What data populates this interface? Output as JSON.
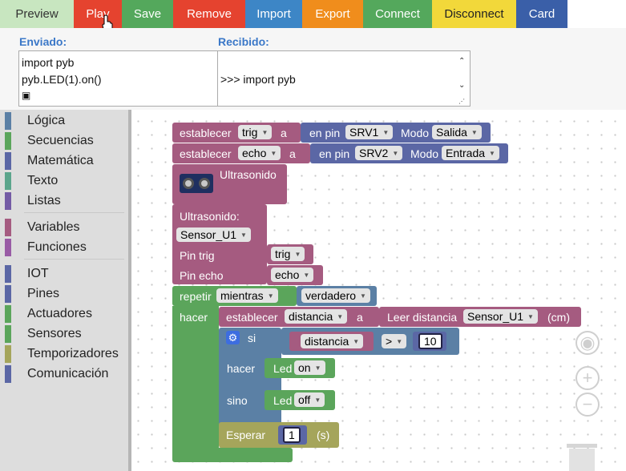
{
  "toolbar": {
    "preview": {
      "label": "Preview",
      "color": "#c8e6c0"
    },
    "play": {
      "label": "Play",
      "color": "#e5432f"
    },
    "save": {
      "label": "Save",
      "color": "#54a85c"
    },
    "remove": {
      "label": "Remove",
      "color": "#e5432f"
    },
    "import": {
      "label": "Import",
      "color": "#3d86c6"
    },
    "export": {
      "label": "Export",
      "color": "#f08d1c"
    },
    "connect": {
      "label": "Connect",
      "color": "#54a85c"
    },
    "disconnect": {
      "label": "Disconnect",
      "color": "#f2d83a"
    },
    "card": {
      "label": "Card",
      "color": "#3a5fa8"
    }
  },
  "console": {
    "sent_label": "Enviado:",
    "received_label": "Recibido:",
    "sent_lines": [
      "import pyb",
      "pyb.LED(1).on()"
    ],
    "received_text": ">>> import pyb"
  },
  "categories": [
    {
      "label": "Lógica",
      "color": "#5b80a5"
    },
    {
      "label": "Secuencias",
      "color": "#5ba55b"
    },
    {
      "label": "Matemática",
      "color": "#5b67a5"
    },
    {
      "label": "Texto",
      "color": "#5ba58c"
    },
    {
      "label": "Listas",
      "color": "#745ba5"
    },
    {
      "label": "Variables",
      "color": "#a55b80"
    },
    {
      "label": "Funciones",
      "color": "#995ba5"
    },
    {
      "label": "IOT",
      "color": "#5b67a5"
    },
    {
      "label": "Pines",
      "color": "#5b67a5"
    },
    {
      "label": "Actuadores",
      "color": "#5ba55b"
    },
    {
      "label": "Sensores",
      "color": "#5ba55b"
    },
    {
      "label": "Temporizadores",
      "color": "#a5a55b"
    },
    {
      "label": "Comunicación",
      "color": "#5b67a5"
    }
  ],
  "blocks": {
    "set1": {
      "label": "establecer",
      "var": "trig",
      "a": "a",
      "pin_label": "en pin",
      "pin": "SRV1",
      "mode_label": "Modo",
      "mode": "Salida"
    },
    "set2": {
      "label": "establecer",
      "var": "echo",
      "a": "a",
      "pin_label": "en pin",
      "pin": "SRV2",
      "mode_label": "Modo",
      "mode": "Entrada"
    },
    "ultra": {
      "title": "Ultrasonido",
      "name_label": "Ultrasonido:",
      "name": "Sensor_U1",
      "trig_label": "Pin trig",
      "trig": "trig",
      "echo_label": "Pin echo",
      "echo": "echo"
    },
    "loop": {
      "label": "repetir",
      "mode": "mientras",
      "cond": "verdadero",
      "do_label": "hacer"
    },
    "set3": {
      "label": "establecer",
      "var": "distancia",
      "a": "a",
      "read_label": "Leer distancia",
      "sensor": "Sensor_U1",
      "unit": "(cm)"
    },
    "if": {
      "si": "si",
      "var": "distancia",
      "op": ">",
      "value": "10",
      "then_label": "hacer",
      "led1_label": "Led",
      "led1_state": "on",
      "else_label": "sino",
      "led2_label": "Led",
      "led2_state": "off"
    },
    "wait": {
      "label": "Esperar",
      "value": "1",
      "unit": "(s)"
    }
  }
}
